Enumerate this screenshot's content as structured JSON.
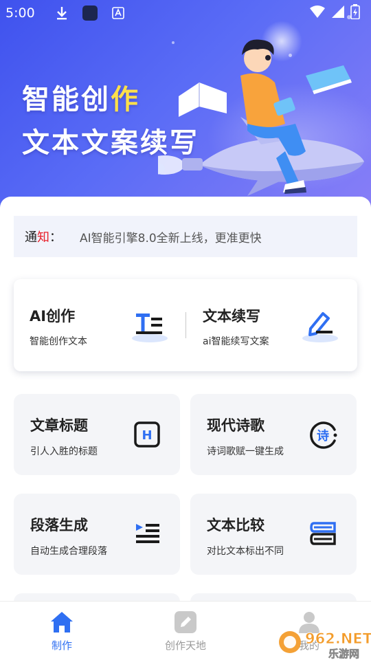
{
  "status_bar": {
    "time": "5:00"
  },
  "banner": {
    "title_line1_part1": "智能创",
    "title_line1_part2": "作",
    "title_line2": "文本文案续写"
  },
  "notice": {
    "label_a": "通",
    "label_b": "知",
    "colon": "：",
    "message": "AI智能引擎8.0全新上线，更准更快"
  },
  "featured": [
    {
      "title": "AI创作",
      "subtitle": "智能创作文本",
      "icon": "text-format-icon"
    },
    {
      "title": "文本续写",
      "subtitle": "ai智能续写文案",
      "icon": "pen-write-icon"
    }
  ],
  "tiles": [
    {
      "title": "文章标题",
      "subtitle": "引人入胜的标题",
      "icon": "heading-h-icon"
    },
    {
      "title": "现代诗歌",
      "subtitle": "诗词歌赋一键生成",
      "icon": "poem-icon"
    },
    {
      "title": "段落生成",
      "subtitle": "自动生成合理段落",
      "icon": "paragraph-list-icon"
    },
    {
      "title": "文本比较",
      "subtitle": "对比文本标出不同",
      "icon": "books-compare-icon"
    }
  ],
  "poem_icon_glyph": "诗",
  "heading_icon_glyph": "H",
  "bottom_nav": [
    {
      "label": "制作",
      "active": true
    },
    {
      "label": "创作天地",
      "active": false
    },
    {
      "label": "我的",
      "active": false
    }
  ],
  "watermark": {
    "brand": "962.NET",
    "sub": "乐游网"
  },
  "colors": {
    "accent": "#2f6ff2",
    "accent_dark": "#1a1a1a",
    "notice_highlight": "#e8202a",
    "nav_active": "#2f6ff2",
    "nav_inactive": "#9a9a9a"
  }
}
